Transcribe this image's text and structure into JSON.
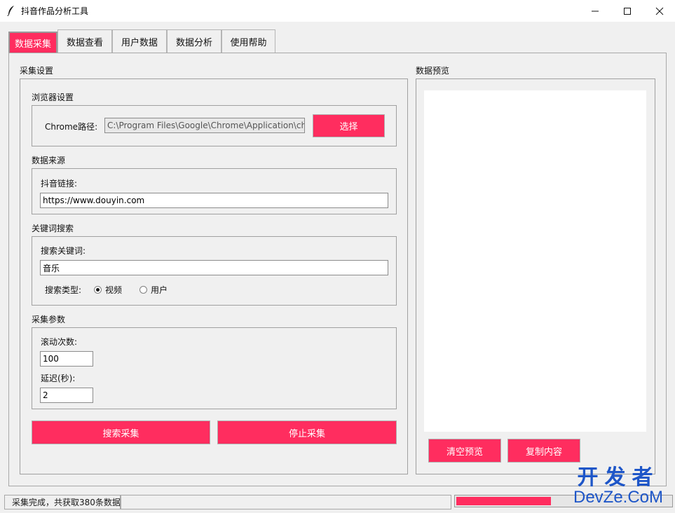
{
  "window": {
    "title": "抖音作品分析工具",
    "icon": "feather-icon"
  },
  "tabs": [
    {
      "label": "数据采集",
      "active": true
    },
    {
      "label": "数据查看",
      "active": false
    },
    {
      "label": "用户数据",
      "active": false
    },
    {
      "label": "数据分析",
      "active": false
    },
    {
      "label": "使用帮助",
      "active": false
    }
  ],
  "collect_settings": {
    "title": "采集设置",
    "browser": {
      "title": "浏览器设置",
      "chrome_path_label": "Chrome路径:",
      "chrome_path_value": "C:\\Program Files\\Google\\Chrome\\Application\\chrome.exe",
      "select_button": "选择"
    },
    "source": {
      "title": "数据来源",
      "link_label": "抖音链接:",
      "link_value": "https://www.douyin.com"
    },
    "keyword": {
      "title": "关键词搜索",
      "keyword_label": "搜索关键词:",
      "keyword_value": "音乐",
      "search_type_label": "搜索类型:",
      "options": [
        {
          "label": "视频",
          "selected": true
        },
        {
          "label": "用户",
          "selected": false
        }
      ]
    },
    "params": {
      "title": "采集参数",
      "scroll_label": "滚动次数:",
      "scroll_value": "100",
      "delay_label": "延迟(秒):",
      "delay_value": "2"
    },
    "search_button": "搜索采集",
    "stop_button": "停止采集"
  },
  "preview": {
    "title": "数据预览",
    "content": "",
    "clear_button": "清空预览",
    "copy_button": "复制内容"
  },
  "status": {
    "text": "采集完成，共获取380条数据",
    "progress_fraction": 0.44
  },
  "watermark": {
    "line1": "开发者",
    "line2": "DevZe.CoM"
  },
  "colors": {
    "accent": "#ff2d5f",
    "watermark": "#1e56c8"
  }
}
